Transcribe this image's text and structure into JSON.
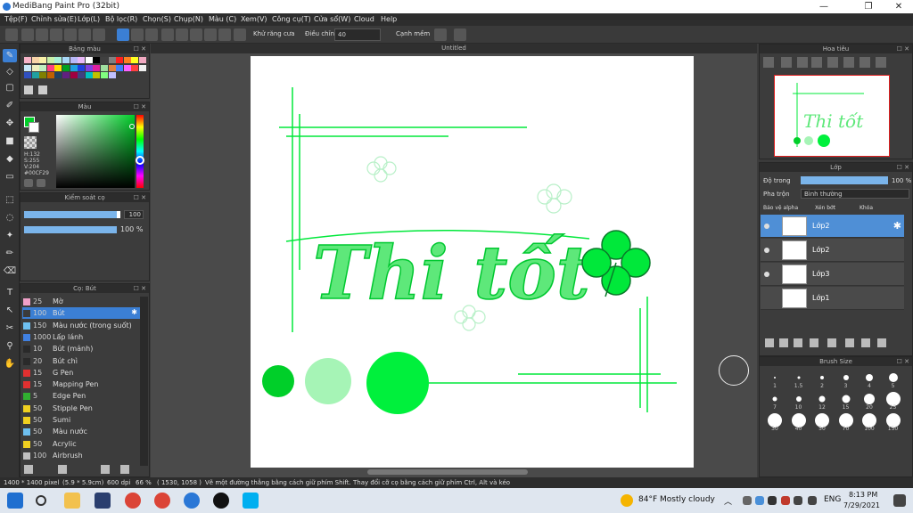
{
  "window": {
    "title": "MediBang Paint Pro (32bit)",
    "min": "—",
    "max": "❐",
    "close": "✕"
  },
  "menu": [
    "Tệp(F)",
    "Chỉnh sửa(E)",
    "Lớp(L)",
    "Bộ lọc(R)",
    "Chọn(S)",
    "Chụp(N)",
    "Màu (C)",
    "Xem(V)",
    "Công cụ(T)",
    "Cửa sổ(W)",
    "Cloud",
    "Help"
  ],
  "toolbar": {
    "antialias_label": "Khử răng cưa",
    "correction_label": "Điều chỉnh",
    "correction_value": "40",
    "snap_label": "Cạnh mềm"
  },
  "panels": {
    "palette_title": "Bảng màu",
    "color_title": "Màu",
    "color": {
      "h": "H:132",
      "s": "S:255",
      "v": "V:204",
      "hex": "#00CF29",
      "primary": "#00cf29"
    },
    "brush_control_title": "Kiểm soát cọ",
    "brush_size_value": "100",
    "brush_opacity_value": "100 %",
    "brushes_title": "Cọ: Bút",
    "brushes": [
      {
        "size": "25",
        "name": "Mờ",
        "color": "#f0a0c8"
      },
      {
        "size": "100",
        "name": "Bút",
        "color": "#3b3b3b",
        "selected": true
      },
      {
        "size": "150",
        "name": "Màu nước (trong suốt)",
        "color": "#6ec0f0"
      },
      {
        "size": "1000",
        "name": "Lấp lánh",
        "color": "#4080e0"
      },
      {
        "size": "10",
        "name": "Bút (mảnh)",
        "color": "#2a2a2a"
      },
      {
        "size": "20",
        "name": "Bút chì",
        "color": "#2a2a2a"
      },
      {
        "size": "15",
        "name": "G Pen",
        "color": "#e03030"
      },
      {
        "size": "15",
        "name": "Mapping Pen",
        "color": "#e03030"
      },
      {
        "size": "5",
        "name": "Edge Pen",
        "color": "#30b030"
      },
      {
        "size": "50",
        "name": "Stipple Pen",
        "color": "#f0d020"
      },
      {
        "size": "50",
        "name": "Sumi",
        "color": "#f0d020"
      },
      {
        "size": "50",
        "name": "Màu nước",
        "color": "#6ec0f0"
      },
      {
        "size": "50",
        "name": "Acrylic",
        "color": "#f0d020"
      },
      {
        "size": "100",
        "name": "Airbrush",
        "color": "#c0c0c0"
      }
    ]
  },
  "canvas": {
    "tab_title": "Untitled",
    "text_main": "Thi tốt",
    "green": "#00e83a"
  },
  "navigator_title": "Hoa tiêu",
  "layers": {
    "title": "Lớp",
    "opacity_label": "Độ trong",
    "opacity_value": "100 %",
    "blend_label": "Pha trộn",
    "blend_value": "Bình thường",
    "protect_alpha": "Bảo vệ alpha",
    "clip": "Xén bớt",
    "lock": "Khóa",
    "items": [
      {
        "name": "Lớp2",
        "selected": true
      },
      {
        "name": "Lớp2"
      },
      {
        "name": "Lớp3"
      },
      {
        "name": "Lớp1"
      }
    ]
  },
  "brush_size_panel": {
    "title": "Brush Size",
    "sizes": [
      "1",
      "1.5",
      "2",
      "3",
      "4",
      "5",
      "7",
      "10",
      "12",
      "15",
      "20",
      "25",
      "30",
      "40",
      "50",
      "70",
      "100",
      "150"
    ]
  },
  "status": {
    "dims": "1400 * 1400 pixel",
    "cm": "(5.9 * 5.9cm)",
    "dpi": "600 dpi",
    "zoom": "66 %",
    "coords": "( 1530, 1058 )",
    "hint": "Vẽ một đường thẳng bằng cách giữ phím Shift. Thay đổi cỡ cọ bằng cách giữ phím Ctrl, Alt và kéo"
  },
  "taskbar": {
    "weather": "84°F  Mostly cloudy",
    "lang": "ENG",
    "time": "8:13 PM",
    "date": "7/29/2021"
  }
}
